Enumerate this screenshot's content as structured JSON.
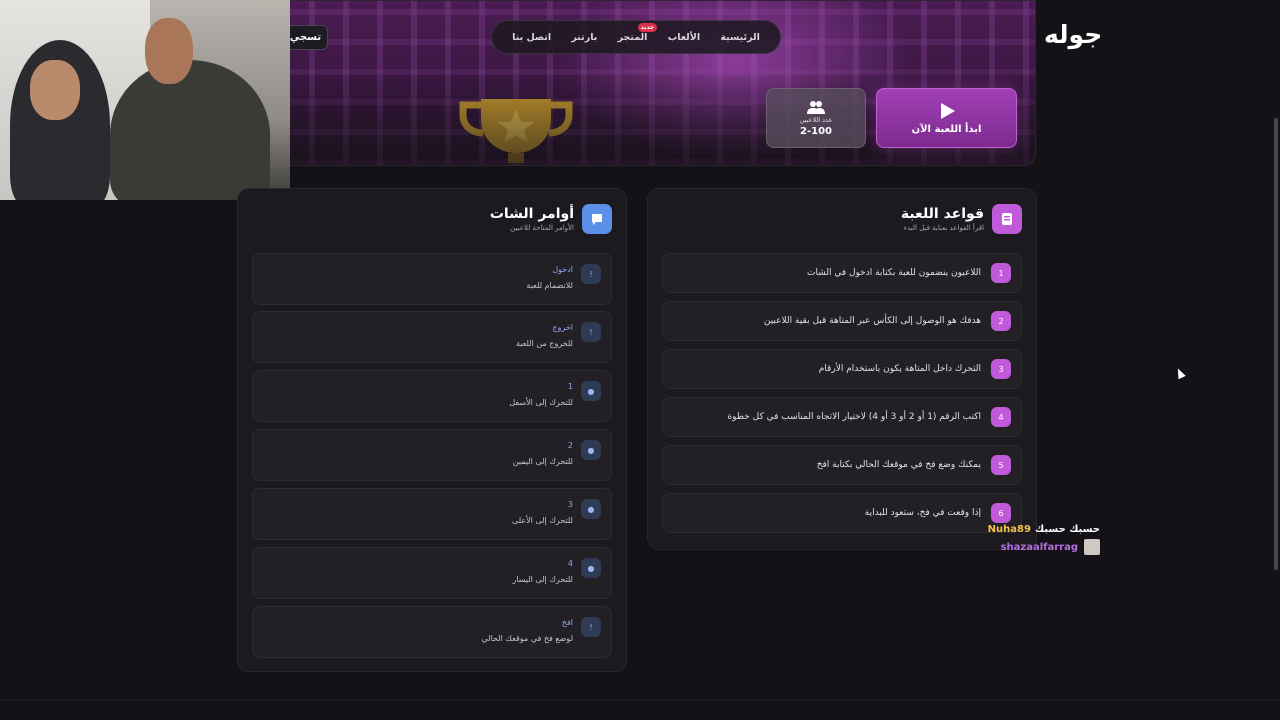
{
  "header": {
    "logo": "جوله",
    "login_label": "تسجي",
    "nav": [
      {
        "label": "الرئيسية"
      },
      {
        "label": "الألعاب"
      },
      {
        "label": "المتجر",
        "badge": "جديد"
      },
      {
        "label": "بارتنر"
      },
      {
        "label": "اتصل بنا"
      }
    ]
  },
  "hero": {
    "play_label": "ابدأ اللعبة الآن",
    "players_label": "عدد اللاعبين",
    "players_value": "2-100"
  },
  "rules_panel": {
    "title": "قواعد اللعبة",
    "subtitle": "اقرأ القواعد بعناية قبل البدء",
    "rules": [
      {
        "num": "1",
        "text": "اللاعبون ينضمون للعبة بكتابة ادخول في الشات"
      },
      {
        "num": "2",
        "text": "هدفك هو الوصول إلى الكأس عبر المتاهة قبل بقية اللاعبين"
      },
      {
        "num": "3",
        "text": "التحرك داخل المتاهة يكون باستخدام الأرقام"
      },
      {
        "num": "4",
        "text": "اكتب الرقم (1 أو 2 أو 3 أو 4) لاختيار الاتجاه المناسب في كل خطوة"
      },
      {
        "num": "5",
        "text": "يمكنك وضع فخ في موقعك الحالي بكتابة افخ"
      },
      {
        "num": "6",
        "text": "إذا وقعت في فخ، ستعود للبداية"
      }
    ]
  },
  "commands_panel": {
    "title": "أوامر الشات",
    "subtitle": "الأوامر المتاحة للاعبين",
    "commands": [
      {
        "icon": "!",
        "code": "ادخول",
        "desc": "للانضمام للعبة"
      },
      {
        "icon": "!",
        "code": "اخروج",
        "desc": "للخروج من اللعبة"
      },
      {
        "icon": "●",
        "code": "1",
        "desc": "للتحرك إلى الأسفل"
      },
      {
        "icon": "●",
        "code": "2",
        "desc": "للتحرك إلى اليمين"
      },
      {
        "icon": "●",
        "code": "3",
        "desc": "للتحرك إلى الأعلى"
      },
      {
        "icon": "●",
        "code": "4",
        "desc": "للتحرك إلى اليسار"
      },
      {
        "icon": "!",
        "code": "افخ",
        "desc": "لوضع فخ في موقعك الحالي"
      }
    ]
  },
  "chat": {
    "message_user": "Nuha89",
    "message_text": "حسبك حسبك",
    "second_user": "shazaalfarrag"
  },
  "colors": {
    "accent": "#c15ad9",
    "command_accent": "#8fa8f0",
    "background": "#141216"
  }
}
